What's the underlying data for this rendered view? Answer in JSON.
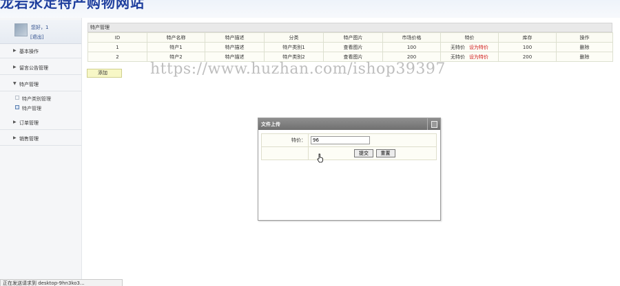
{
  "site": {
    "title": "龙岩永定特产购物网站"
  },
  "user": {
    "greeting": "您好，1",
    "logout": "[退出]"
  },
  "sidebar": {
    "menus": [
      {
        "label": "基本操作",
        "arrow": "▶"
      },
      {
        "label": "留言公告管理",
        "arrow": "▶"
      },
      {
        "label": "特产管理",
        "arrow": "▼"
      },
      {
        "label": "订单管理",
        "arrow": "▶"
      },
      {
        "label": "销售管理",
        "arrow": "▶"
      }
    ],
    "subitems": [
      {
        "label": "特产类别管理"
      },
      {
        "label": "特产管理"
      }
    ]
  },
  "panel": {
    "title": "特产管理"
  },
  "table": {
    "columns": [
      "ID",
      "特产名称",
      "特产描述",
      "分类",
      "特产图片",
      "市场价格",
      "特价",
      "库存",
      "操作"
    ],
    "rows": [
      {
        "id": "1",
        "name": "特产1",
        "desc": "特产描述",
        "category": "特产类别1",
        "image": "查看图片",
        "price": "100",
        "special": "无特价",
        "set_special": "设为特价",
        "stock": "100",
        "action": "删除"
      },
      {
        "id": "2",
        "name": "特产2",
        "desc": "特产描述",
        "category": "特产类别2",
        "image": "查看图片",
        "price": "200",
        "special": "无特价",
        "set_special": "设为特价",
        "stock": "200",
        "action": "删除"
      }
    ]
  },
  "buttons": {
    "add": "添加"
  },
  "watermark": "https://www.huzhan.com/ishop39397",
  "dialog": {
    "title": "文件上传",
    "price_label": "特价：",
    "price_value": "96",
    "submit": "提交",
    "reset": "重置"
  },
  "statusbar": {
    "text": "正在发送请求到 desktop-9hn3ko3..."
  },
  "colors": {
    "title_blue": "#1f3f9e",
    "link_red": "#d01818",
    "add_button_bg": "#f7f7c6",
    "dialog_bar": "#7f7f7f"
  }
}
